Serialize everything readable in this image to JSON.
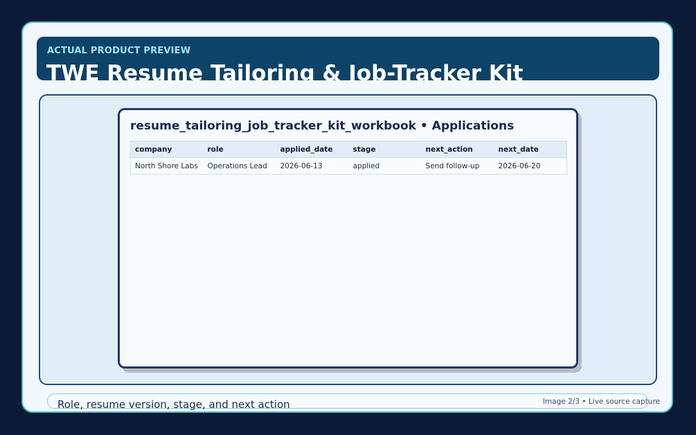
{
  "banner": {
    "eyebrow": "ACTUAL PRODUCT PREVIEW",
    "title": "TWE Resume Tailoring & Job-Tracker Kit"
  },
  "sheet": {
    "title": "resume_tailoring_job_tracker_kit_workbook • Applications",
    "columns": [
      "company",
      "role",
      "applied_date",
      "stage",
      "next_action",
      "next_date"
    ],
    "rows": [
      [
        "North Shore Labs",
        "Operations Lead",
        "2026-06-13",
        "applied",
        "Send follow-up",
        "2026-06-20"
      ]
    ]
  },
  "caption": {
    "text": "Role, resume version, stage, and next action",
    "counter": "Image 2/3 • Live source capture"
  },
  "colors": {
    "background": "#0b1b36",
    "banner": "#0d4269",
    "frame_border": "#4bb8cc",
    "sheet_border": "#1e3a67"
  }
}
